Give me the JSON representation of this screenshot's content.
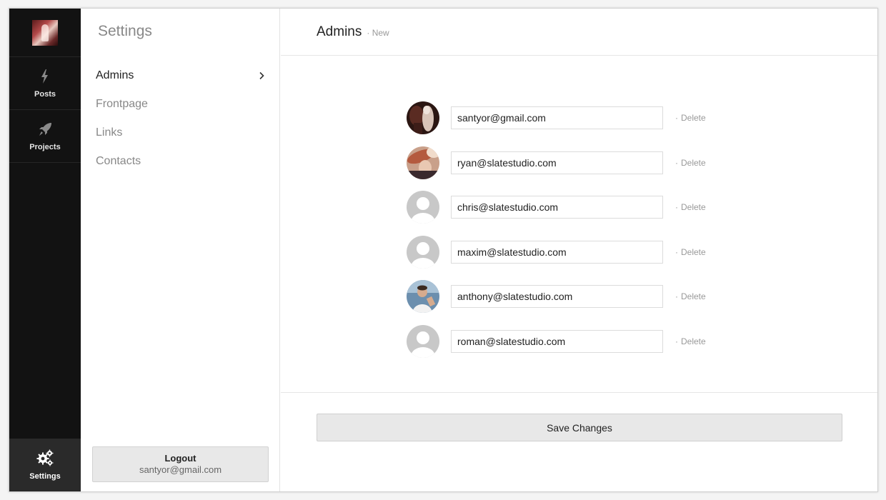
{
  "rail": {
    "items": [
      {
        "label": "Posts",
        "icon": "lightning-icon"
      },
      {
        "label": "Projects",
        "icon": "rocket-icon"
      }
    ],
    "settings_label": "Settings"
  },
  "menu": {
    "title": "Settings",
    "items": [
      {
        "label": "Admins",
        "active": true
      },
      {
        "label": "Frontpage"
      },
      {
        "label": "Links"
      },
      {
        "label": "Contacts"
      }
    ],
    "logout": {
      "label": "Logout",
      "email": "santyor@gmail.com"
    }
  },
  "main": {
    "title": "Admins",
    "subtitle": "New",
    "delete_label": "Delete",
    "admins": [
      {
        "email": "santyor@gmail.com",
        "avatar": "photo-dark"
      },
      {
        "email": "ryan@slatestudio.com",
        "avatar": "photo-warm"
      },
      {
        "email": "chris@slatestudio.com",
        "avatar": "default"
      },
      {
        "email": "maxim@slatestudio.com",
        "avatar": "default"
      },
      {
        "email": "anthony@slatestudio.com",
        "avatar": "photo-blue"
      },
      {
        "email": "roman@slatestudio.com",
        "avatar": "default"
      }
    ],
    "save_label": "Save Changes"
  }
}
